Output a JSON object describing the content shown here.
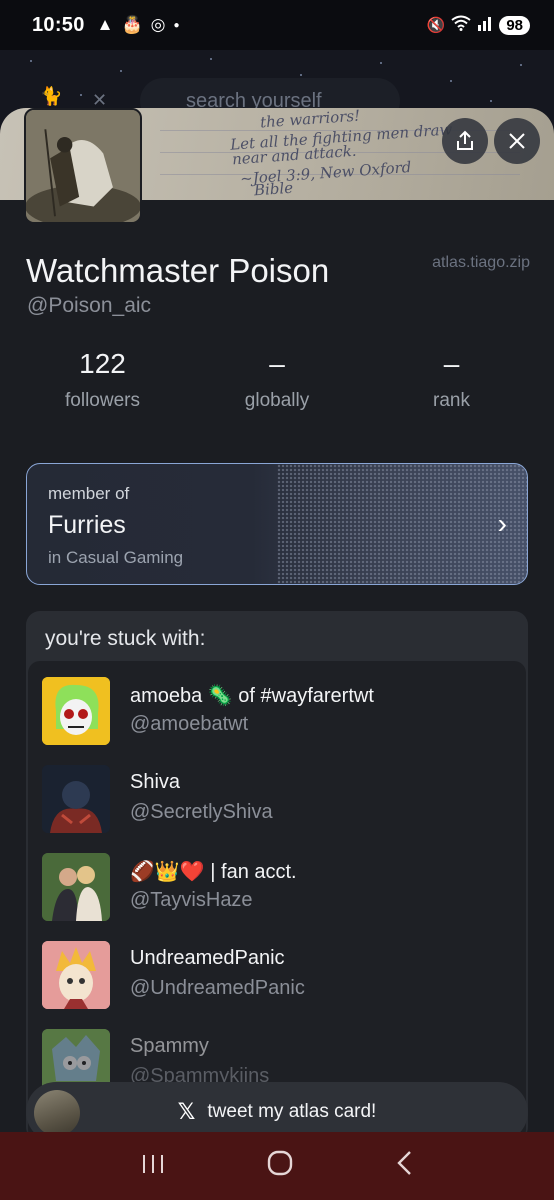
{
  "status_bar": {
    "time": "10:50",
    "left_icons": [
      "app-icon",
      "cake-icon",
      "whatsapp-icon",
      "dot-icon"
    ],
    "battery": "98"
  },
  "background": {
    "search_placeholder": "search yourself"
  },
  "profile": {
    "display_name": "Watchmaster Poison",
    "handle": "@Poison_aic",
    "site": "atlas.tiago.zip",
    "banner_text": [
      "the warriors!",
      "Let all the fighting men draw",
      "near and attack.",
      "~Joel 3:9, New Oxford",
      "Bible"
    ]
  },
  "stats": [
    {
      "value": "122",
      "label": "followers"
    },
    {
      "value": "–",
      "label": "globally"
    },
    {
      "value": "–",
      "label": "rank"
    }
  ],
  "member": {
    "label": "member of",
    "name": "Furries",
    "sub": "in Casual Gaming"
  },
  "stuck": {
    "title": "you're stuck with:",
    "items": [
      {
        "name": "amoeba 🦠 of #wayfarertwt",
        "handle": "@amoebatwt"
      },
      {
        "name": "Shiva",
        "handle": "@SecretlyShiva"
      },
      {
        "name": "🏈👑❤️ | fan acct.",
        "handle": "@TayvisHaze"
      },
      {
        "name": "UndreamedPanic",
        "handle": "@UndreamedPanic"
      },
      {
        "name": "Spammy",
        "handle": "@Spammykiins"
      }
    ]
  },
  "tweet_button": {
    "icon": "x-logo-icon",
    "label": "tweet my atlas card!"
  },
  "colors": {
    "sheet_bg": "#1b1d22",
    "accent_border": "#8aa6d6",
    "nav_bar": "#4a1414"
  }
}
